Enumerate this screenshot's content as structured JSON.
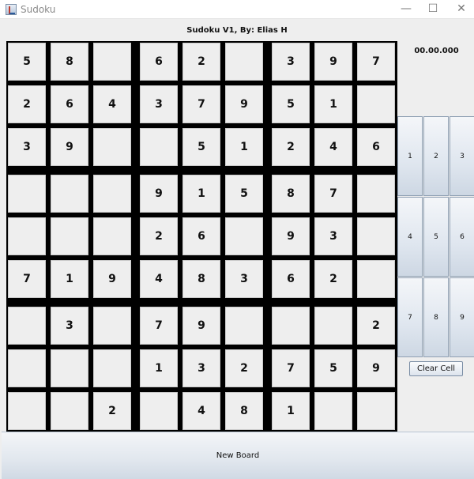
{
  "window": {
    "title": "Sudoku",
    "minimize_glyph": "—",
    "maximize_glyph": "☐",
    "close_glyph": "✕"
  },
  "header": {
    "title": "Sudoku V1, By: Elias H"
  },
  "timer": {
    "value": "00.00.000"
  },
  "board": {
    "rows": [
      [
        "5",
        "8",
        "",
        "6",
        "2",
        "",
        "3",
        "9",
        "7"
      ],
      [
        "2",
        "6",
        "4",
        "3",
        "7",
        "9",
        "5",
        "1",
        ""
      ],
      [
        "3",
        "9",
        "",
        "",
        "5",
        "1",
        "2",
        "4",
        "6"
      ],
      [
        "",
        "",
        "",
        "9",
        "1",
        "5",
        "8",
        "7",
        ""
      ],
      [
        "",
        "",
        "",
        "2",
        "6",
        "",
        "9",
        "3",
        ""
      ],
      [
        "7",
        "1",
        "9",
        "4",
        "8",
        "3",
        "6",
        "2",
        ""
      ],
      [
        "",
        "3",
        "",
        "7",
        "9",
        "",
        "",
        "",
        "2"
      ],
      [
        "",
        "",
        "",
        "1",
        "3",
        "2",
        "7",
        "5",
        "9"
      ],
      [
        "",
        "",
        "2",
        "",
        "4",
        "8",
        "1",
        "",
        ""
      ]
    ]
  },
  "numpad": {
    "keys": [
      "1",
      "2",
      "3",
      "4",
      "5",
      "6",
      "7",
      "8",
      "9"
    ]
  },
  "buttons": {
    "clear_cell": "Clear Cell",
    "new_board": "New Board"
  }
}
